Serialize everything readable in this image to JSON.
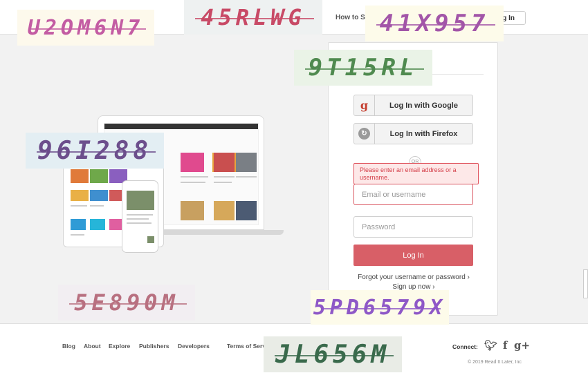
{
  "header": {
    "how_to_save": "How to Save",
    "login_label": "Log In"
  },
  "captchas": [
    {
      "text": "U2OM6N7",
      "color": "#c35ca3",
      "bg": "#fdf9ec"
    },
    {
      "text": "45RLWG",
      "color": "#c84a66",
      "bg": "#eef1f1"
    },
    {
      "text": "41X957",
      "color": "#a255a8",
      "bg": "#fdfbea"
    },
    {
      "text": "9T15RL",
      "color": "#4f8a4f",
      "bg": "#eaf3e7"
    },
    {
      "text": "96I288",
      "color": "#6c4e8c",
      "bg": "#e3eef3"
    },
    {
      "text": "5E890M",
      "color": "#b87080",
      "bg": "#f2eef2"
    },
    {
      "text": "5PD6579X",
      "color": "#8e58c7",
      "bg": "#fdfbea"
    },
    {
      "text": "JL656M",
      "color": "#3a6a4c",
      "bg": "#e9ece6"
    }
  ],
  "login": {
    "google_label": "Log In with Google",
    "firefox_label": "Log In with Firefox",
    "or_label": "OR",
    "error_message": "Please enter an email address or a username.",
    "email_placeholder": "Email or username",
    "password_placeholder": "Password",
    "submit_label": "Log In",
    "forgot_label": "Forgot your username or password ›",
    "signup_label": "Sign up now ›"
  },
  "footer": {
    "links": [
      "Blog",
      "About",
      "Explore",
      "Publishers",
      "Developers",
      "Terms of Service"
    ],
    "connect_label": "Connect:",
    "copyright": "© 2019 Read It Later, Inc"
  },
  "colors": {
    "brand": "#d85f67",
    "error": "#d43f49"
  }
}
